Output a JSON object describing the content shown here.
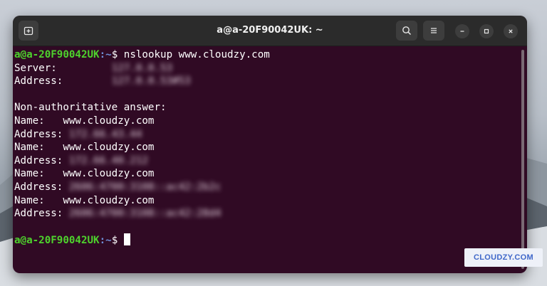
{
  "window": {
    "title": "a@a-20F90042UK: ~"
  },
  "terminal": {
    "lines": [
      {
        "kind": "prompt",
        "user": "a@a-20F90042UK",
        "path": ":~",
        "symbol": "$ ",
        "command": "nslookup www.cloudzy.com"
      },
      {
        "kind": "kv",
        "label": "Server:",
        "pad": "         ",
        "value": "127.0.0.53",
        "blurred": true
      },
      {
        "kind": "kv",
        "label": "Address:",
        "pad": "        ",
        "value": "127.0.0.53#53",
        "blurred": true
      },
      {
        "kind": "blank"
      },
      {
        "kind": "text",
        "text": "Non-authoritative answer:"
      },
      {
        "kind": "kv",
        "label": "Name:",
        "pad": "   ",
        "value": "www.cloudzy.com",
        "blurred": false
      },
      {
        "kind": "kv",
        "label": "Address:",
        "pad": " ",
        "value": "172.66.43.44",
        "blurred": true
      },
      {
        "kind": "kv",
        "label": "Name:",
        "pad": "   ",
        "value": "www.cloudzy.com",
        "blurred": false
      },
      {
        "kind": "kv",
        "label": "Address:",
        "pad": " ",
        "value": "172.66.40.212",
        "blurred": true
      },
      {
        "kind": "kv",
        "label": "Name:",
        "pad": "   ",
        "value": "www.cloudzy.com",
        "blurred": false
      },
      {
        "kind": "kv",
        "label": "Address:",
        "pad": " ",
        "value": "2606:4700:3108::ac42:2b2c",
        "blurred": true
      },
      {
        "kind": "kv",
        "label": "Name:",
        "pad": "   ",
        "value": "www.cloudzy.com",
        "blurred": false
      },
      {
        "kind": "kv",
        "label": "Address:",
        "pad": " ",
        "value": "2606:4700:3108::ac42:28d4",
        "blurred": true
      },
      {
        "kind": "blank"
      },
      {
        "kind": "prompt",
        "user": "a@a-20F90042UK",
        "path": ":~",
        "symbol": "$ ",
        "command": "",
        "cursor": true
      }
    ]
  },
  "watermark": {
    "text": "CLOUDZY.COM"
  },
  "colors": {
    "terminal_bg": "#300a24",
    "prompt_user": "#4ed22d",
    "prompt_path": "#6e8fd6",
    "titlebar_bg": "#2b2b2b",
    "watermark_text": "#3f67c9"
  },
  "icons": {
    "newtab": "new-tab-icon",
    "search": "search-icon",
    "menu": "hamburger-menu-icon",
    "minimize": "minimize-icon",
    "maximize": "maximize-icon",
    "close": "close-icon"
  }
}
